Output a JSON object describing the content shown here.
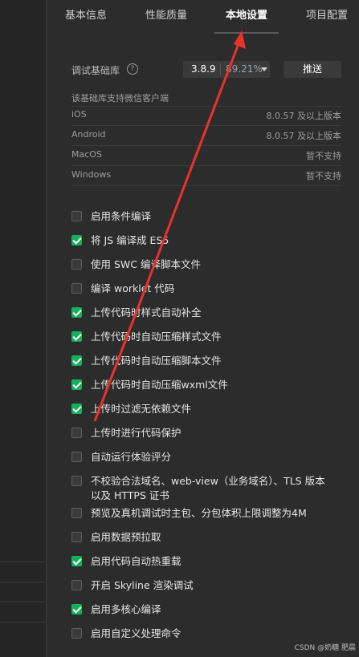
{
  "tabs": [
    "基本信息",
    "性能质量",
    "本地设置",
    "项目配置"
  ],
  "active_tab": 2,
  "lib": {
    "label": "调试基础库",
    "help": "?",
    "version": "3.8.9",
    "percent": "89.21%",
    "push_label": "推送"
  },
  "support": {
    "title": "该基础库支持微信客户端",
    "rows": [
      {
        "platform": "iOS",
        "value": "8.0.57 及以上版本"
      },
      {
        "platform": "Android",
        "value": "8.0.57 及以上版本"
      },
      {
        "platform": "MacOS",
        "value": "暂不支持"
      },
      {
        "platform": "Windows",
        "value": "暂不支持"
      }
    ]
  },
  "options": [
    {
      "label": "启用条件编译",
      "checked": false
    },
    {
      "label": "将 JS 编译成 ES5",
      "checked": true
    },
    {
      "label": "使用 SWC 编译脚本文件",
      "checked": false
    },
    {
      "label": "编译 worklet 代码",
      "checked": false
    },
    {
      "label": "上传代码时样式自动补全",
      "checked": true
    },
    {
      "label": "上传代码时自动压缩样式文件",
      "checked": true
    },
    {
      "label": "上传代码时自动压缩脚本文件",
      "checked": true
    },
    {
      "label": "上传代码时自动压缩wxml文件",
      "checked": true
    },
    {
      "label": "上传时过滤无依赖文件",
      "checked": true
    },
    {
      "label": "上传时进行代码保护",
      "checked": false
    },
    {
      "label": "自动运行体验评分",
      "checked": false
    },
    {
      "label": "不校验合法域名、web-view（业务域名）、TLS 版本以及 HTTPS 证书",
      "checked": false
    },
    {
      "label": "预览及真机调试时主包、分包体积上限调整为4M",
      "checked": false
    },
    {
      "label": "启用数据预拉取",
      "checked": false
    },
    {
      "label": "启用代码自动热重载",
      "checked": true
    },
    {
      "label": "开启 Skyline 渲染调试",
      "checked": false
    },
    {
      "label": "启用多核心编译",
      "checked": true
    },
    {
      "label": "启用自定义处理命令",
      "checked": false
    }
  ],
  "watermark": "CSDN @奶糖 肥晨",
  "colors": {
    "check_on": "#13b15c",
    "arrow": "#e8322b",
    "background": "#2c2c2c"
  }
}
